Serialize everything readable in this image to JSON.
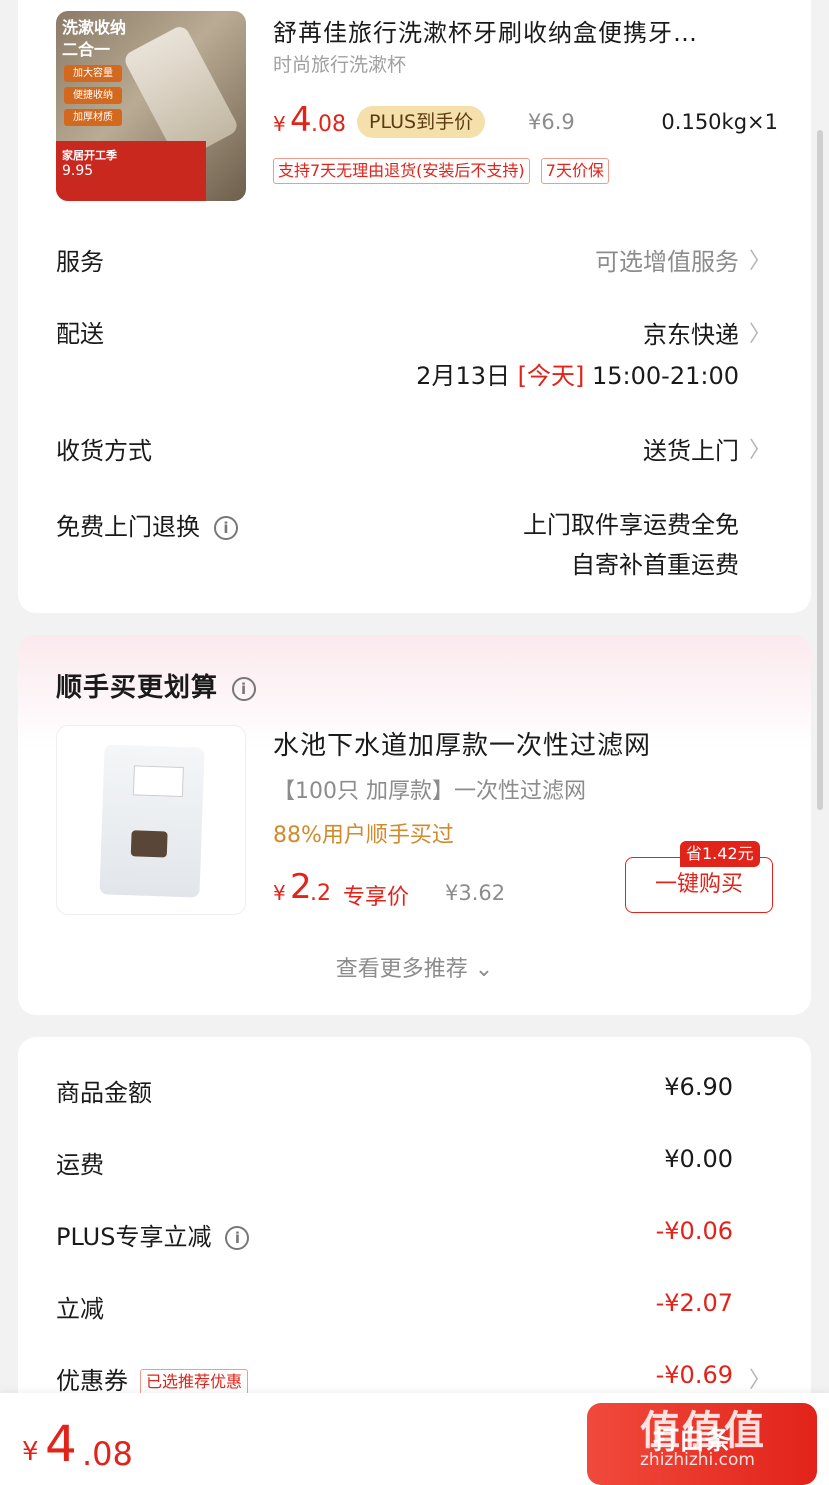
{
  "product": {
    "title": "舒苒佳旅行洗漱杯牙刷收纳盒便携牙…",
    "subtitle": "时尚旅行洗漱杯",
    "price_currency": "¥",
    "price_int": "4",
    "price_dec": ".08",
    "plus_label": "PLUS到手价",
    "original_price": "¥6.9",
    "quantity": "0.150kg×1",
    "badges": [
      "支持7天无理由退货(安装后不支持)",
      "7天价保"
    ],
    "thumb": {
      "title": "洗漱收纳 二合一",
      "tags": [
        "加大容量",
        "便捷收纳",
        "加厚材质"
      ],
      "promo_title": "家居开工季",
      "promo_price": "9.95"
    }
  },
  "rows": {
    "service": {
      "label": "服务",
      "value": "可选增值服务"
    },
    "delivery": {
      "label": "配送",
      "value": "京东快递",
      "date": "2月13日",
      "today": "[今天]",
      "time": "15:00-21:00"
    },
    "receive": {
      "label": "收货方式",
      "value": "送货上门"
    },
    "free_return": {
      "label": "免费上门退换",
      "line1": "上门取件享运费全免",
      "line2": "自寄补首重运费"
    }
  },
  "recommend": {
    "title": "顺手买更划算",
    "name": "水池下水道加厚款一次性过滤网",
    "spec": "【100只 加厚款】一次性过滤网",
    "buy_rate": "88%用户顺手买过",
    "price_currency": "¥",
    "price_int": "2",
    "price_dec": ".2",
    "price_label": "专享价",
    "old_price": "¥3.62",
    "save_tag": "省1.42元",
    "buy_button": "一键购买",
    "more": "查看更多推荐 ⌄"
  },
  "summary": {
    "goods": {
      "label": "商品金额",
      "value": "¥6.90"
    },
    "shipping": {
      "label": "运费",
      "value": "¥0.00"
    },
    "plus_discount": {
      "label": "PLUS专享立减",
      "value": "-¥0.06"
    },
    "discount": {
      "label": "立减",
      "value": "-¥2.07"
    },
    "coupon": {
      "label": "优惠券",
      "tag": "已选推荐优惠",
      "value": "-¥0.69"
    }
  },
  "bottom": {
    "currency": "¥",
    "int": "4",
    "dec": ".08",
    "pay_button": "打白条"
  },
  "watermark": {
    "text": "值值值",
    "site": "zhizhizhi.com"
  },
  "icons": {
    "info": "info-icon",
    "chevron": "chevron-right-icon"
  },
  "colors": {
    "accent": "#e2231a",
    "plus_gold": "#f5dfaa",
    "buy_rate": "#d18a2c"
  }
}
